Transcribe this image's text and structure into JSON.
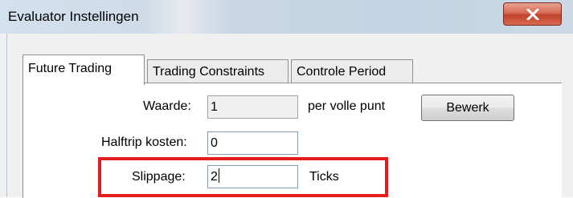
{
  "window": {
    "title": "Evaluator Instellingen",
    "close_icon": "close-icon"
  },
  "tabs": [
    {
      "label": "Future Trading",
      "active": true
    },
    {
      "label": "Trading Constraints",
      "active": false
    },
    {
      "label": "Controle Period",
      "active": false
    }
  ],
  "form": {
    "waarde_label": "Waarde:",
    "waarde_value": "1",
    "waarde_unit": "per volle punt",
    "edit_button": "Bewerk",
    "halftrip_label": "Halftrip kosten:",
    "halftrip_value": "0",
    "slippage_label": "Slippage:",
    "slippage_value": "2",
    "slippage_unit": "Ticks"
  },
  "colors": {
    "highlight": "#e41e1e",
    "close_button": "#c1432b"
  }
}
